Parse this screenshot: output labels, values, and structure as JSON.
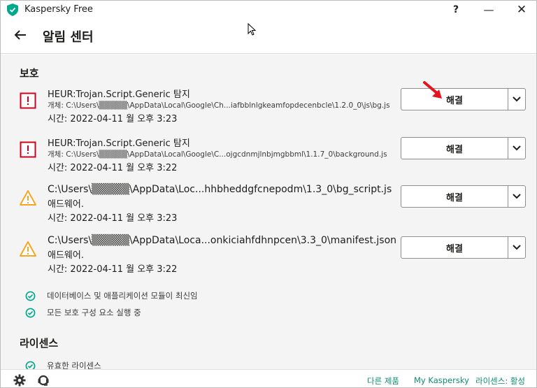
{
  "window": {
    "title": "Kaspersky Free",
    "help_label": "?",
    "minimize_label": "—",
    "close_label": "✕"
  },
  "header": {
    "title": "알림 센터"
  },
  "protection": {
    "heading": "보호",
    "threats": [
      {
        "icon": "danger-icon",
        "name": "HEUR:Trojan.Script.Generic 탐지",
        "path": "개체: C:\\Users\\▒▒▒▒▒\\AppData\\Local\\Google\\Ch...iafbblnlgkeamfopdecenbcle\\1.2.0_0\\js\\bg.js",
        "time": "시간: 2022-04-11 월 오후 3:23",
        "action_label": "해결"
      },
      {
        "icon": "danger-icon",
        "name": "HEUR:Trojan.Script.Generic 탐지",
        "path": "개체: C:\\Users\\▒▒▒▒▒\\AppData\\Local\\Google\\C...ojgcdnmjlnbjmgbbml\\1.1.7_0\\background.js",
        "time": "시간: 2022-04-11 월 오후 3:22",
        "action_label": "해결"
      },
      {
        "icon": "warning-icon",
        "name": "C:\\Users\\▒▒▒▒▒\\AppData\\Loc...hhbheddgfcnepodm\\1.3_0\\bg_script.js",
        "sub": "애드웨어.",
        "time": "시간: 2022-04-11 월 오후 3:23",
        "action_label": "해결"
      },
      {
        "icon": "warning-icon",
        "name": "C:\\Users\\▒▒▒▒▒\\AppData\\Loca...onkiciahfdhnpcen\\3.3_0\\manifest.json",
        "sub": "애드웨어.",
        "time": "시간: 2022-04-11 월 오후 3:22",
        "action_label": "해결"
      }
    ],
    "statuses": [
      "데이터베이스 및 애플리케이션 모듈이 최신임",
      "모든 보호 구성 요소 실행 중"
    ]
  },
  "license": {
    "heading": "라이센스",
    "status": "유효한 라이센스"
  },
  "footer": {
    "link_other": "다른 제품",
    "link_my": "My Kaspersky",
    "link_license": "라이센스: 활성"
  },
  "colors": {
    "accent": "#00a88e",
    "danger": "#d0021b",
    "warning": "#f5a623",
    "link": "#0f8a72",
    "arrow": "#e3141e"
  }
}
